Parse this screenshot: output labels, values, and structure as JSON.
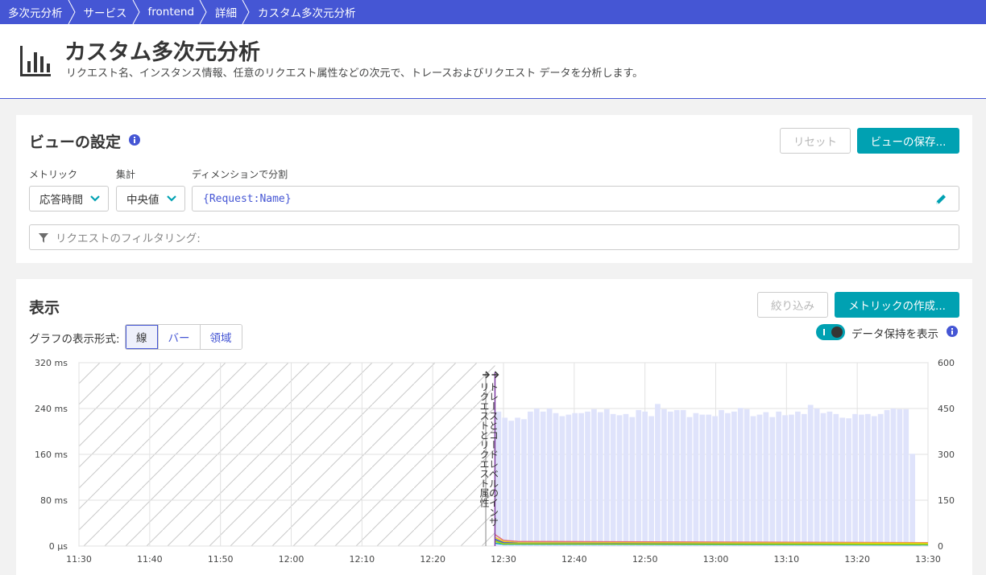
{
  "breadcrumb": [
    "多次元分析",
    "サービス",
    "frontend",
    "詳細",
    "カスタム多次元分析"
  ],
  "header": {
    "title": "カスタム多次元分析",
    "subtitle": "リクエスト名、インスタンス情報、任意のリクエスト属性などの次元で、トレースおよびリクエスト データを分析します。",
    "icon": "bar-chart-icon"
  },
  "view_settings": {
    "title": "ビューの設定",
    "reset_label": "リセット",
    "save_label": "ビューの保存...",
    "metric_label": "メトリック",
    "metric_value": "応答時間",
    "aggregation_label": "集計",
    "aggregation_value": "中央値",
    "dimension_label": "ディメンションで分割",
    "dimension_value": "{Request:Name}",
    "filter_placeholder": "リクエストのフィルタリング:"
  },
  "display": {
    "title": "表示",
    "narrow_label": "絞り込み",
    "create_metric_label": "メトリックの作成...",
    "chart_format_label": "グラフの表示形式:",
    "formats": [
      "線",
      "バー",
      "領域"
    ],
    "active_format": "線",
    "retention_label": "データ保持を表示"
  },
  "colors": {
    "brand": "#4556d4",
    "accent": "#00a1b2",
    "bars": "#dfe3fb"
  },
  "chart_data": {
    "type": "line",
    "x_ticks": [
      "11:30",
      "11:40",
      "11:50",
      "12:00",
      "12:10",
      "12:20",
      "12:30",
      "12:40",
      "12:50",
      "13:00",
      "13:10",
      "13:20",
      "13:30"
    ],
    "y_left_ticks": [
      "320 ms",
      "240 ms",
      "160 ms",
      "80 ms",
      "0 µs"
    ],
    "y_right_ticks": [
      "600",
      "450",
      "300",
      "150",
      "0"
    ],
    "y_left_range_ms": [
      0,
      320
    ],
    "y_right_range": [
      0,
      600
    ],
    "x_range_minutes": [
      0,
      120
    ],
    "markers": [
      {
        "label": "リクエストとリクエスト属性",
        "x_minutes": 57.5
      },
      {
        "label": "トレースとコードレベルのインサ",
        "x_minutes": 58.8
      }
    ],
    "retention_hatched_until_minutes": 58.8,
    "request_counts": [
      {
        "x_minutes": 59.3,
        "value": 440
      },
      {
        "x_minutes": 60.2,
        "value": 420
      },
      {
        "x_minutes": 61.1,
        "value": 410
      },
      {
        "x_minutes": 62.0,
        "value": 420
      },
      {
        "x_minutes": 62.9,
        "value": 415
      },
      {
        "x_minutes": 63.8,
        "value": 440
      },
      {
        "x_minutes": 64.7,
        "value": 450
      },
      {
        "x_minutes": 65.6,
        "value": 440
      },
      {
        "x_minutes": 66.5,
        "value": 450
      },
      {
        "x_minutes": 67.4,
        "value": 435
      },
      {
        "x_minutes": 68.3,
        "value": 425
      },
      {
        "x_minutes": 69.2,
        "value": 430
      },
      {
        "x_minutes": 70.1,
        "value": 435
      },
      {
        "x_minutes": 71.0,
        "value": 435
      },
      {
        "x_minutes": 71.9,
        "value": 440
      },
      {
        "x_minutes": 72.8,
        "value": 448
      },
      {
        "x_minutes": 73.7,
        "value": 438
      },
      {
        "x_minutes": 74.6,
        "value": 448
      },
      {
        "x_minutes": 75.5,
        "value": 432
      },
      {
        "x_minutes": 76.4,
        "value": 428
      },
      {
        "x_minutes": 77.3,
        "value": 432
      },
      {
        "x_minutes": 78.2,
        "value": 422
      },
      {
        "x_minutes": 79.1,
        "value": 445
      },
      {
        "x_minutes": 80.0,
        "value": 440
      },
      {
        "x_minutes": 80.9,
        "value": 425
      },
      {
        "x_minutes": 81.8,
        "value": 465
      },
      {
        "x_minutes": 82.7,
        "value": 448
      },
      {
        "x_minutes": 83.6,
        "value": 440
      },
      {
        "x_minutes": 84.5,
        "value": 445
      },
      {
        "x_minutes": 85.4,
        "value": 445
      },
      {
        "x_minutes": 86.3,
        "value": 422
      },
      {
        "x_minutes": 87.2,
        "value": 435
      },
      {
        "x_minutes": 88.1,
        "value": 430
      },
      {
        "x_minutes": 89.0,
        "value": 430
      },
      {
        "x_minutes": 89.9,
        "value": 425
      },
      {
        "x_minutes": 90.8,
        "value": 445
      },
      {
        "x_minutes": 91.7,
        "value": 435
      },
      {
        "x_minutes": 92.6,
        "value": 440
      },
      {
        "x_minutes": 93.5,
        "value": 452
      },
      {
        "x_minutes": 94.4,
        "value": 448
      },
      {
        "x_minutes": 95.3,
        "value": 425
      },
      {
        "x_minutes": 96.2,
        "value": 430
      },
      {
        "x_minutes": 97.1,
        "value": 438
      },
      {
        "x_minutes": 98.0,
        "value": 422
      },
      {
        "x_minutes": 98.9,
        "value": 440
      },
      {
        "x_minutes": 99.8,
        "value": 428
      },
      {
        "x_minutes": 100.7,
        "value": 430
      },
      {
        "x_minutes": 101.6,
        "value": 440
      },
      {
        "x_minutes": 102.5,
        "value": 432
      },
      {
        "x_minutes": 103.4,
        "value": 462
      },
      {
        "x_minutes": 104.3,
        "value": 450
      },
      {
        "x_minutes": 105.2,
        "value": 435
      },
      {
        "x_minutes": 106.1,
        "value": 440
      },
      {
        "x_minutes": 107.0,
        "value": 432
      },
      {
        "x_minutes": 107.9,
        "value": 420
      },
      {
        "x_minutes": 108.8,
        "value": 418
      },
      {
        "x_minutes": 109.7,
        "value": 432
      },
      {
        "x_minutes": 110.6,
        "value": 430
      },
      {
        "x_minutes": 111.5,
        "value": 432
      },
      {
        "x_minutes": 112.4,
        "value": 425
      },
      {
        "x_minutes": 113.3,
        "value": 432
      },
      {
        "x_minutes": 114.2,
        "value": 445
      },
      {
        "x_minutes": 115.1,
        "value": 450
      },
      {
        "x_minutes": 116.0,
        "value": 448
      },
      {
        "x_minutes": 116.9,
        "value": 448
      },
      {
        "x_minutes": 117.8,
        "value": 302
      }
    ],
    "series": [
      {
        "name": "",
        "color": "#e4707b",
        "points": [
          [
            58.8,
            20
          ],
          [
            60,
            10
          ],
          [
            62,
            8
          ],
          [
            120,
            6
          ]
        ]
      },
      {
        "name": "",
        "color": "#7dc540",
        "points": [
          [
            58.8,
            10
          ],
          [
            60,
            5
          ],
          [
            62,
            5
          ],
          [
            120,
            4
          ]
        ]
      },
      {
        "name": "",
        "color": "#f5d30f",
        "points": [
          [
            58.8,
            15
          ],
          [
            60,
            8
          ],
          [
            62,
            6
          ],
          [
            120,
            5
          ]
        ]
      },
      {
        "name": "",
        "color": "#4556d4",
        "points": [
          [
            58.8,
            12
          ],
          [
            60,
            6
          ],
          [
            62,
            5
          ],
          [
            120,
            3
          ]
        ]
      },
      {
        "name": "",
        "color": "#00a1b2",
        "points": [
          [
            58.8,
            5
          ],
          [
            60,
            3
          ],
          [
            62,
            3
          ],
          [
            120,
            2
          ]
        ]
      },
      {
        "name": "",
        "color": "#b4dc00",
        "points": [
          [
            58.8,
            8
          ],
          [
            60,
            4
          ],
          [
            62,
            4
          ],
          [
            120,
            3
          ]
        ]
      }
    ],
    "grid": true,
    "title": "",
    "xlabel": "",
    "ylabel": ""
  }
}
